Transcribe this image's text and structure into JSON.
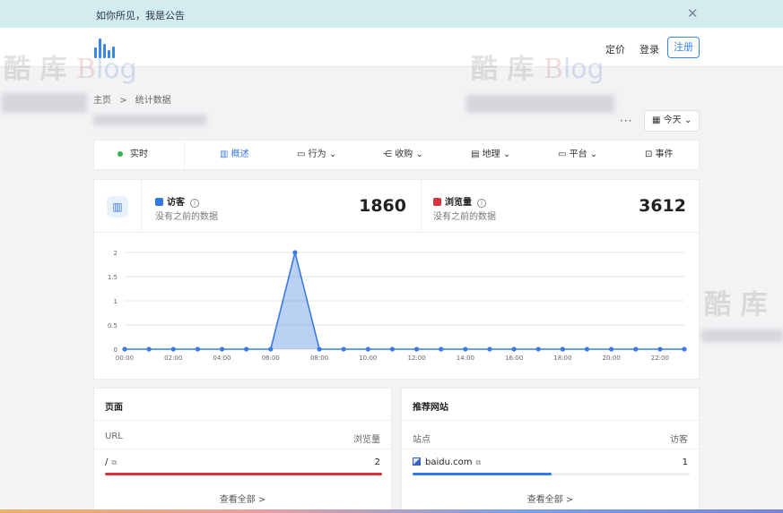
{
  "notice": {
    "text": "如你所见，我是公告",
    "close": "✕"
  },
  "nav": {
    "pricing": "定价",
    "login": "登录",
    "register": "注册"
  },
  "watermark": {
    "a": "酷",
    "b": "库",
    "c": "B",
    "d": "log"
  },
  "breadcrumb": {
    "home": "主页",
    "sep": ">",
    "current": "统计数据"
  },
  "toolbar": {
    "more": "···",
    "date": "今天"
  },
  "tabs": [
    {
      "label": "实时"
    },
    {
      "label": "概述"
    },
    {
      "label": "行为"
    },
    {
      "label": "收购"
    },
    {
      "label": "地理"
    },
    {
      "label": "平台"
    },
    {
      "label": "事件"
    }
  ],
  "stats": {
    "visitors": {
      "label": "访客",
      "sub": "没有之前的数据",
      "value": "1860",
      "color": "#2e7be6"
    },
    "pageviews": {
      "label": "浏览量",
      "sub": "没有之前的数据",
      "value": "3612",
      "color": "#d8343f"
    }
  },
  "chart_data": {
    "type": "area",
    "x": [
      "00:00",
      "01:00",
      "02:00",
      "03:00",
      "04:00",
      "05:00",
      "06:00",
      "07:00",
      "08:00",
      "09:00",
      "10:00",
      "11:00",
      "12:00",
      "13:00",
      "14:00",
      "15:00",
      "16:00",
      "17:00",
      "18:00",
      "19:00",
      "20:00",
      "21:00",
      "22:00",
      "23:00"
    ],
    "xticks": [
      "00:00",
      "02:00",
      "04:00",
      "06:00",
      "08:00",
      "10:00",
      "12:00",
      "14:00",
      "16:00",
      "18:00",
      "20:00",
      "22:00"
    ],
    "series": [
      {
        "values": [
          0,
          0,
          0,
          0,
          0,
          0,
          0,
          2,
          0,
          0,
          0,
          0,
          0,
          0,
          0,
          0,
          0,
          0,
          0,
          0,
          0,
          0,
          0,
          0
        ],
        "color": "#3a7be0"
      }
    ],
    "ylim": [
      0,
      2
    ],
    "yticks": [
      "0",
      "0.5",
      "1",
      "1.5",
      "2"
    ],
    "grid": true
  },
  "pages_card": {
    "title": "页面",
    "col1": "URL",
    "col2": "浏览量",
    "row_url": "/",
    "row_value": "2",
    "fill": 1.0,
    "view_all": "查看全部 >",
    "bar_color": "#d8343f"
  },
  "sites_card": {
    "title": "推荐网站",
    "col1": "站点",
    "col2": "访客",
    "row_site": "baidu.com",
    "row_value": "1",
    "fill": 0.5,
    "view_all": "查看全部 >",
    "bar_color": "#2e7be6"
  }
}
